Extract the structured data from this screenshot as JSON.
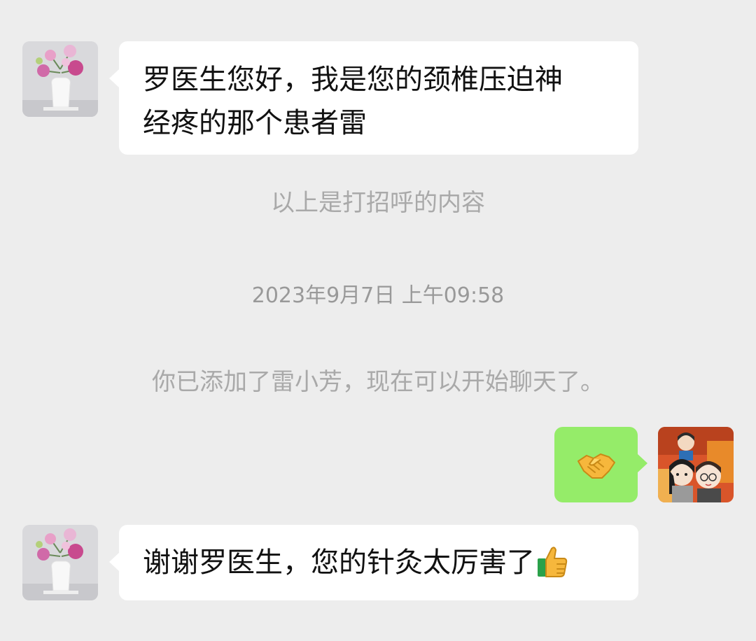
{
  "messages": [
    {
      "side": "incoming",
      "text_line1": "罗医生您好，我是您的颈椎压迫神",
      "text_line2": "经疼的那个患者雷"
    },
    {
      "side": "outgoing",
      "emoji": "handshake-emoji"
    },
    {
      "side": "incoming",
      "text": "谢谢罗医生，您的针灸太厉害了",
      "emoji": "thumbs-up-emoji"
    }
  ],
  "system_messages": {
    "greeting_note": "以上是打招呼的内容",
    "timestamp": "2023年9月7日 上午09:58",
    "added_notice": "你已添加了雷小芳，现在可以开始聊天了。"
  },
  "avatars": {
    "contact": "flower-vase-avatar",
    "self": "cartoon-couple-avatar"
  },
  "colors": {
    "background": "#ededed",
    "incoming_bubble": "#ffffff",
    "outgoing_bubble": "#95ec69",
    "system_text": "#a9a9a9"
  }
}
